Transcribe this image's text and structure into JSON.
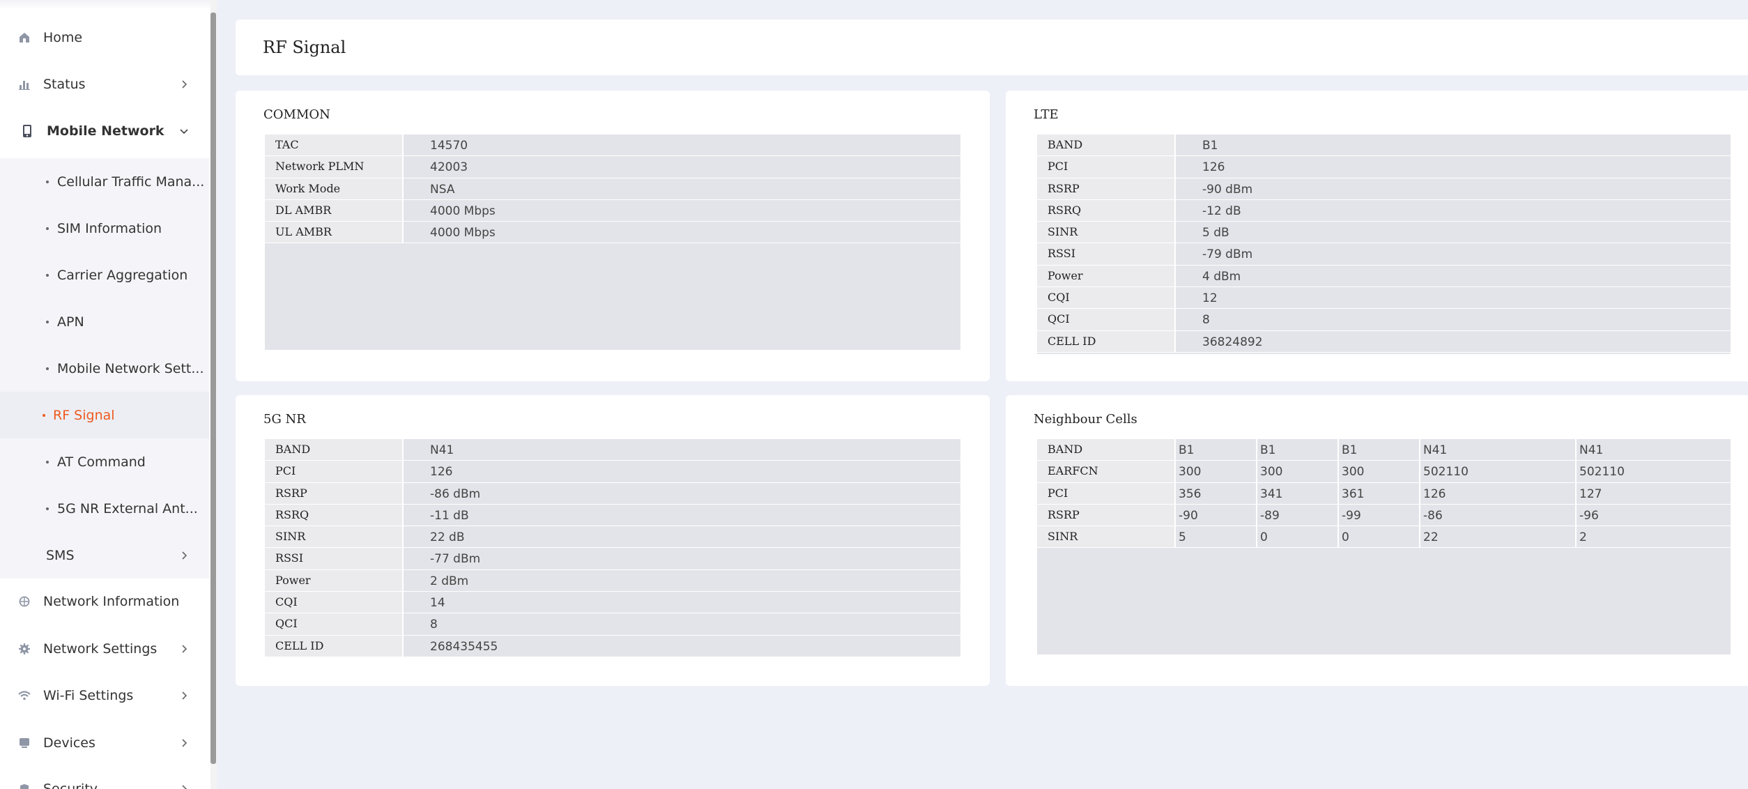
{
  "sidebar": {
    "items": [
      {
        "label": "Home",
        "icon": "home-icon"
      },
      {
        "label": "Status",
        "icon": "bar-chart-icon"
      },
      {
        "label": "Mobile Network",
        "icon": "phone-icon"
      },
      {
        "label": "Cellular Traffic Mana..."
      },
      {
        "label": "SIM Information"
      },
      {
        "label": "Carrier Aggregation"
      },
      {
        "label": "APN"
      },
      {
        "label": "Mobile Network Sett..."
      },
      {
        "label": "RF Signal"
      },
      {
        "label": "AT Command"
      },
      {
        "label": "5G NR External Ant..."
      },
      {
        "label": "SMS"
      },
      {
        "label": "Network Information",
        "icon": "globe-icon"
      },
      {
        "label": "Network Settings",
        "icon": "gear-icon"
      },
      {
        "label": "Wi-Fi Settings",
        "icon": "wifi-icon"
      },
      {
        "label": "Devices",
        "icon": "monitor-icon"
      },
      {
        "label": "Security",
        "icon": "shield-icon"
      }
    ],
    "active_color": "#ef5a1e"
  },
  "header": {
    "title": "RF Signal"
  },
  "common": {
    "title": "COMMON",
    "rows": [
      {
        "k": "TAC",
        "v": "14570"
      },
      {
        "k": "Network PLMN",
        "v": "42003"
      },
      {
        "k": "Work Mode",
        "v": "NSA"
      },
      {
        "k": "DL AMBR",
        "v": "4000 Mbps"
      },
      {
        "k": "UL AMBR",
        "v": "4000 Mbps"
      }
    ]
  },
  "lte": {
    "title": "LTE",
    "rows": [
      {
        "k": "BAND",
        "v": "B1"
      },
      {
        "k": "PCI",
        "v": "126"
      },
      {
        "k": "RSRP",
        "v": "-90 dBm"
      },
      {
        "k": "RSRQ",
        "v": "-12 dB"
      },
      {
        "k": "SINR",
        "v": "5 dB"
      },
      {
        "k": "RSSI",
        "v": "-79 dBm"
      },
      {
        "k": "Power",
        "v": "4 dBm"
      },
      {
        "k": "CQI",
        "v": "12"
      },
      {
        "k": "QCI",
        "v": "8"
      },
      {
        "k": "CELL ID",
        "v": "36824892"
      }
    ]
  },
  "nr": {
    "title": "5G NR",
    "rows": [
      {
        "k": "BAND",
        "v": "N41"
      },
      {
        "k": "PCI",
        "v": "126"
      },
      {
        "k": "RSRP",
        "v": "-86 dBm"
      },
      {
        "k": "RSRQ",
        "v": "-11 dB"
      },
      {
        "k": "SINR",
        "v": "22 dB"
      },
      {
        "k": "RSSI",
        "v": "-77 dBm"
      },
      {
        "k": "Power",
        "v": "2 dBm"
      },
      {
        "k": "CQI",
        "v": "14"
      },
      {
        "k": "QCI",
        "v": "8"
      },
      {
        "k": "CELL ID",
        "v": "268435455"
      }
    ]
  },
  "neighbour": {
    "title": "Neighbour Cells",
    "rows": [
      {
        "k": "BAND",
        "v": [
          "B1",
          "B1",
          "B1",
          "N41",
          "N41"
        ]
      },
      {
        "k": "EARFCN",
        "v": [
          "300",
          "300",
          "300",
          "502110",
          "502110"
        ]
      },
      {
        "k": "PCI",
        "v": [
          "356",
          "341",
          "361",
          "126",
          "127"
        ]
      },
      {
        "k": "RSRP",
        "v": [
          "-90",
          "-89",
          "-99",
          "-86",
          "-96"
        ]
      },
      {
        "k": "SINR",
        "v": [
          "5",
          "0",
          "0",
          "22",
          "2"
        ]
      }
    ]
  }
}
